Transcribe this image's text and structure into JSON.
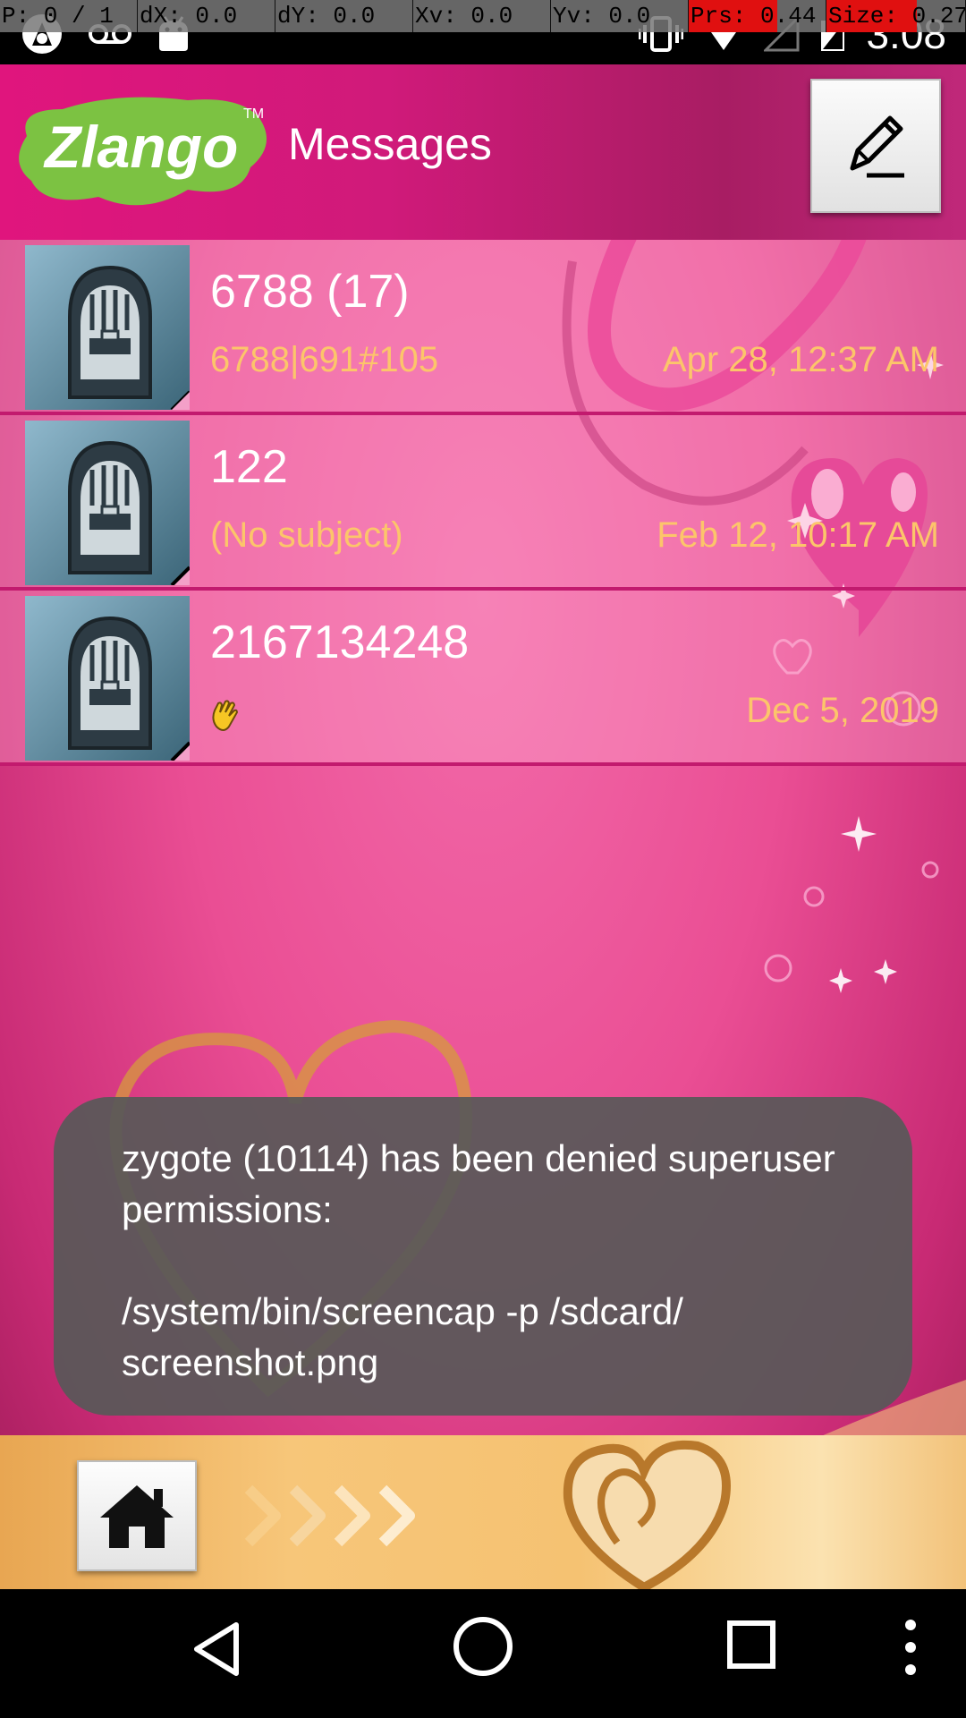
{
  "debug_overlay": {
    "pointer": "P: 0 / 1",
    "dx": "dX: 0.0",
    "dy": "dY: 0.0",
    "xv": "Xv: 0.0",
    "yv": "Yv: 0.0",
    "prs": "Prs: 0.44",
    "size": "Size: 0.27"
  },
  "status_bar": {
    "time": "3:08",
    "icons_left": [
      "bug-icon",
      "voicemail-icon",
      "android-icon"
    ],
    "icons_right": [
      "vibrate-icon",
      "wifi-icon",
      "signal-icon",
      "battery-icon"
    ]
  },
  "header": {
    "logo_text": "Zlango",
    "logo_tm": "TM",
    "title": "Messages",
    "compose_icon": "pencil-icon"
  },
  "conversations": [
    {
      "name": "6788 (17)",
      "snippet": "6788|691#105",
      "date": "Apr 28, 12:37 AM"
    },
    {
      "name": "122",
      "snippet": "(No subject)",
      "date": "Feb 12, 10:17 AM"
    },
    {
      "name": "2167134248",
      "snippet": "",
      "snippet_icon": "waving-hand-icon",
      "date": "Dec 5, 2019"
    }
  ],
  "toast": {
    "line1": "zygote (10114) has been denied superuser permissions:",
    "line2": "/system/bin/screencap -p /sdcard/ screenshot.png"
  },
  "bottom_bar": {
    "home_icon": "home-icon",
    "arrows_icon": "chevrons-right-icon",
    "heart_icon": "heart-icon"
  },
  "nav_bar": {
    "back": "back-icon",
    "home": "home-circle-icon",
    "recents": "recents-icon",
    "menu": "more-vert-icon"
  },
  "colors": {
    "accent_pink": "#e0157d",
    "list_pink": "#ee5fa2",
    "snippet_gold": "#fcc56a",
    "toast_bg": "#585858",
    "bottom_gold": "#f5c272",
    "logo_green": "#7cc242"
  }
}
